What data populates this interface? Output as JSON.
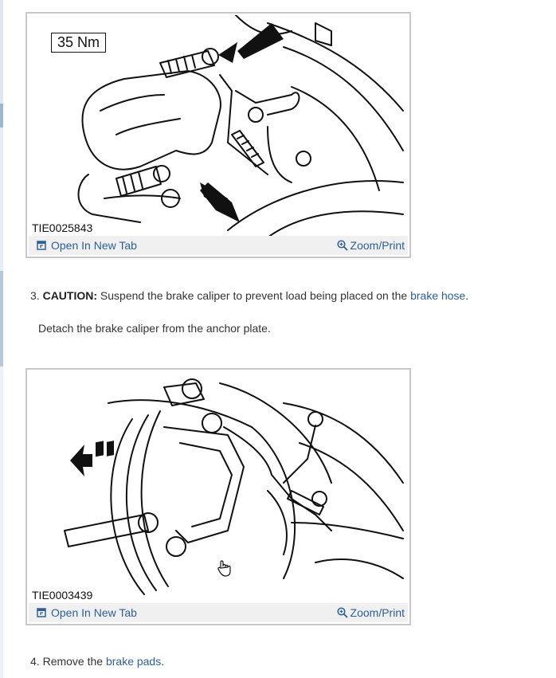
{
  "figures": [
    {
      "id_label": "TIE0025843",
      "torque_label": "35 Nm",
      "open_label": "Open In New Tab",
      "zoom_label": "Zoom/Print",
      "icons": [
        "open-new-tab-icon",
        "magnifier-icon"
      ]
    },
    {
      "id_label": "TIE0003439",
      "open_label": "Open In New Tab",
      "zoom_label": "Zoom/Print",
      "icons": [
        "open-new-tab-icon",
        "magnifier-icon"
      ]
    }
  ],
  "step3": {
    "number": "3.",
    "caution_label": "CAUTION:",
    "text_before": " Suspend the brake caliper to prevent load being placed on the ",
    "link_text": "brake hose",
    "text_after": ".",
    "detail": "Detach the brake caliper from the anchor plate."
  },
  "step4": {
    "number": "4.",
    "text_before": " Remove the ",
    "link_text": "brake pads",
    "text_after": "."
  },
  "colors": {
    "link": "#2c5f98",
    "toolbar_bg": "#f0f0f0",
    "border": "#c9c9c9",
    "text": "#333333"
  }
}
